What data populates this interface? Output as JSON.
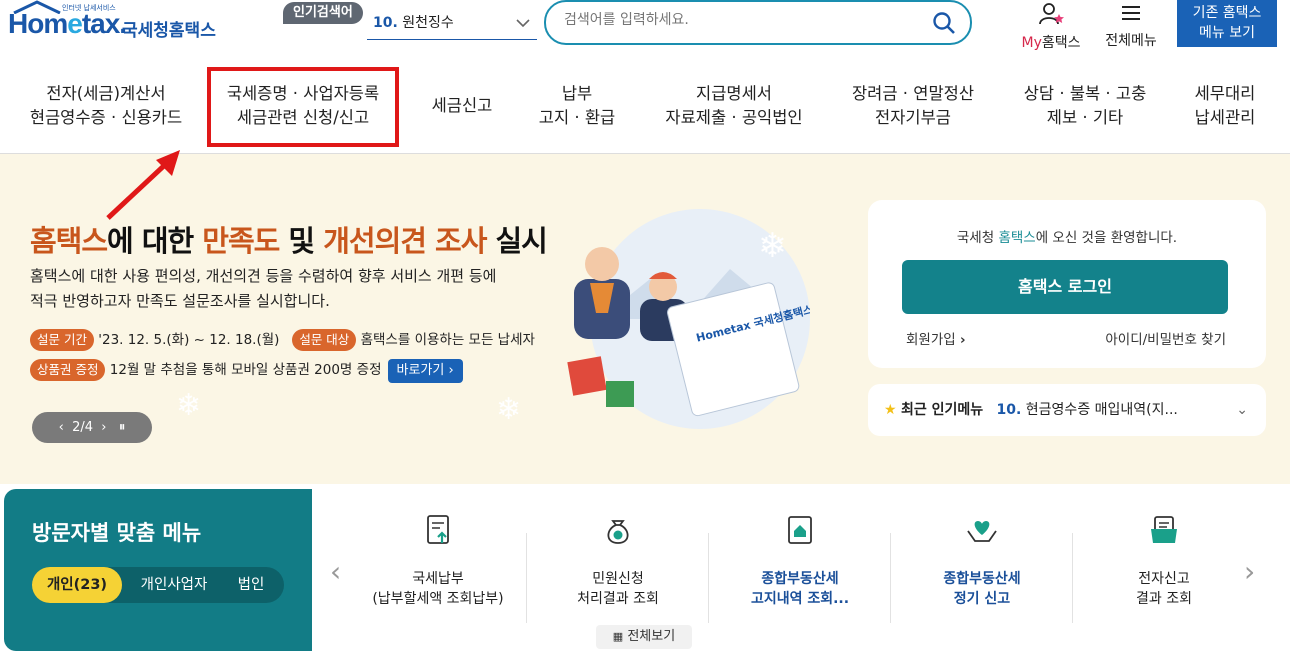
{
  "header": {
    "logo_word_a": "Hom",
    "logo_word_e": "e",
    "logo_word_b": "tax.",
    "logo_small": "인터넷 납세서비스",
    "logo_kr": "국세청홈택스",
    "popular_tag": "인기검색어",
    "popular_rank": "10.",
    "popular_term": "원천징수",
    "search_placeholder": "검색어를 입력하세요.",
    "myhome_my": "My",
    "myhome_rest": "홈택스",
    "allmenu": "전체메뉴",
    "old_btn_line1": "기존 홈택스",
    "old_btn_line2": "메뉴 보기"
  },
  "gnb": [
    {
      "l1": "전자(세금)계산서",
      "l2": "현금영수증 · 신용카드"
    },
    {
      "l1": "국세증명 · 사업자등록",
      "l2": "세금관련 신청/신고"
    },
    {
      "l1": "세금신고",
      "l2": ""
    },
    {
      "l1": "납부",
      "l2": "고지 · 환급"
    },
    {
      "l1": "지급명세서",
      "l2": "자료제출 · 공익법인"
    },
    {
      "l1": "장려금 · 연말정산",
      "l2": "전자기부금"
    },
    {
      "l1": "상담 · 불복 · 고충",
      "l2": "제보 · 기타"
    },
    {
      "l1": "세무대리",
      "l2": "납세관리"
    }
  ],
  "hero": {
    "t1": "홈택스",
    "t2": "에 대한 ",
    "t3": "만족도",
    "t4": " 및 ",
    "t5": "개선의견 조사",
    "t6": " 실시",
    "desc1": "홈택스에 대한 사용 편의성, 개선의견 등을 수렴하여 향후 서비스 개편 등에",
    "desc2": "적극 반영하고자 만족도 설문조사를 실시합니다.",
    "pill_period": "설문 기간",
    "period": "'23. 12. 5.(화) ~ 12. 18.(월)",
    "pill_target": "설문 대상",
    "target": "홈택스를 이용하는 모든 납세자",
    "pill_gift": "상품권 증정",
    "gift": "12월 말 추첨을 통해 모바일 상품권 200명 증정",
    "goto": "바로가기",
    "pager": "2/4",
    "pager_progress": "2 of 4"
  },
  "login": {
    "welcome_a": "국세청 ",
    "welcome_b": "홈택스",
    "welcome_c": "에 오신 것을 환영합니다.",
    "login_btn": "홈택스 로그인",
    "join": "회원가입",
    "find": "아이디/비밀번호 찾기"
  },
  "recent": {
    "title": "최근 인기메뉴",
    "rank": "10.",
    "item": "현금영수증 매입내역(지..."
  },
  "visitor": {
    "title": "방문자별 맞춤 메뉴",
    "tabs": [
      "개인(23)",
      "개인사업자",
      "법인"
    ]
  },
  "quick": [
    {
      "l1": "국세납부",
      "l2": "(납부할세액 조회납부)",
      "icon": "document-upload-icon"
    },
    {
      "l1": "민원신청",
      "l2": "처리결과 조회",
      "icon": "money-bag-icon"
    },
    {
      "l1": "종합부동산세",
      "l2": "고지내역 조회...",
      "icon": "house-document-icon"
    },
    {
      "l1": "종합부동산세",
      "l2": "정기 신고",
      "icon": "heart-hands-icon"
    },
    {
      "l1": "전자신고",
      "l2": "결과 조회",
      "icon": "folder-document-icon"
    }
  ],
  "allview": "전체보기",
  "colors": {
    "brand": "#1a57a8",
    "teal": "#13828b",
    "orange": "#c8561c",
    "highlight": "#e01818"
  }
}
